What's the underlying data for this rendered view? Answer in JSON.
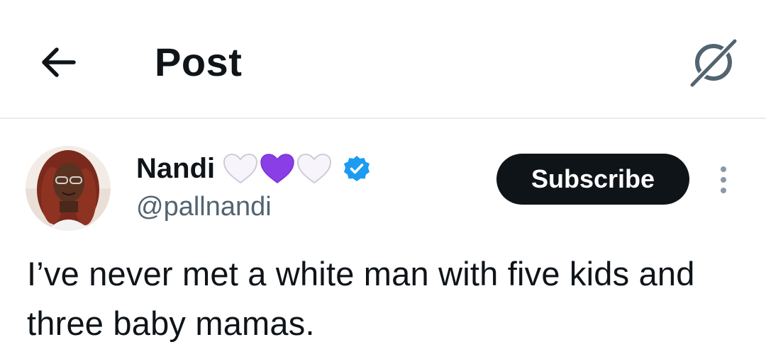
{
  "header": {
    "title": "Post",
    "back_icon": "arrow-left-icon",
    "grok_icon": "grok-icon"
  },
  "author": {
    "display_name": "Nandi",
    "name_emojis": [
      "white-heart",
      "purple-heart",
      "white-heart"
    ],
    "verified": true,
    "verified_color": "#1d9bf0",
    "handle": "@pallnandi"
  },
  "actions": {
    "subscribe_label": "Subscribe",
    "more_icon": "more-vertical-icon"
  },
  "post": {
    "text": "I’ve never met a white man with five kids and three baby mamas."
  },
  "colors": {
    "text_primary": "#0f1419",
    "text_secondary": "#536471",
    "button_bg": "#0f1419",
    "purple_heart": "#8a3ee6"
  }
}
